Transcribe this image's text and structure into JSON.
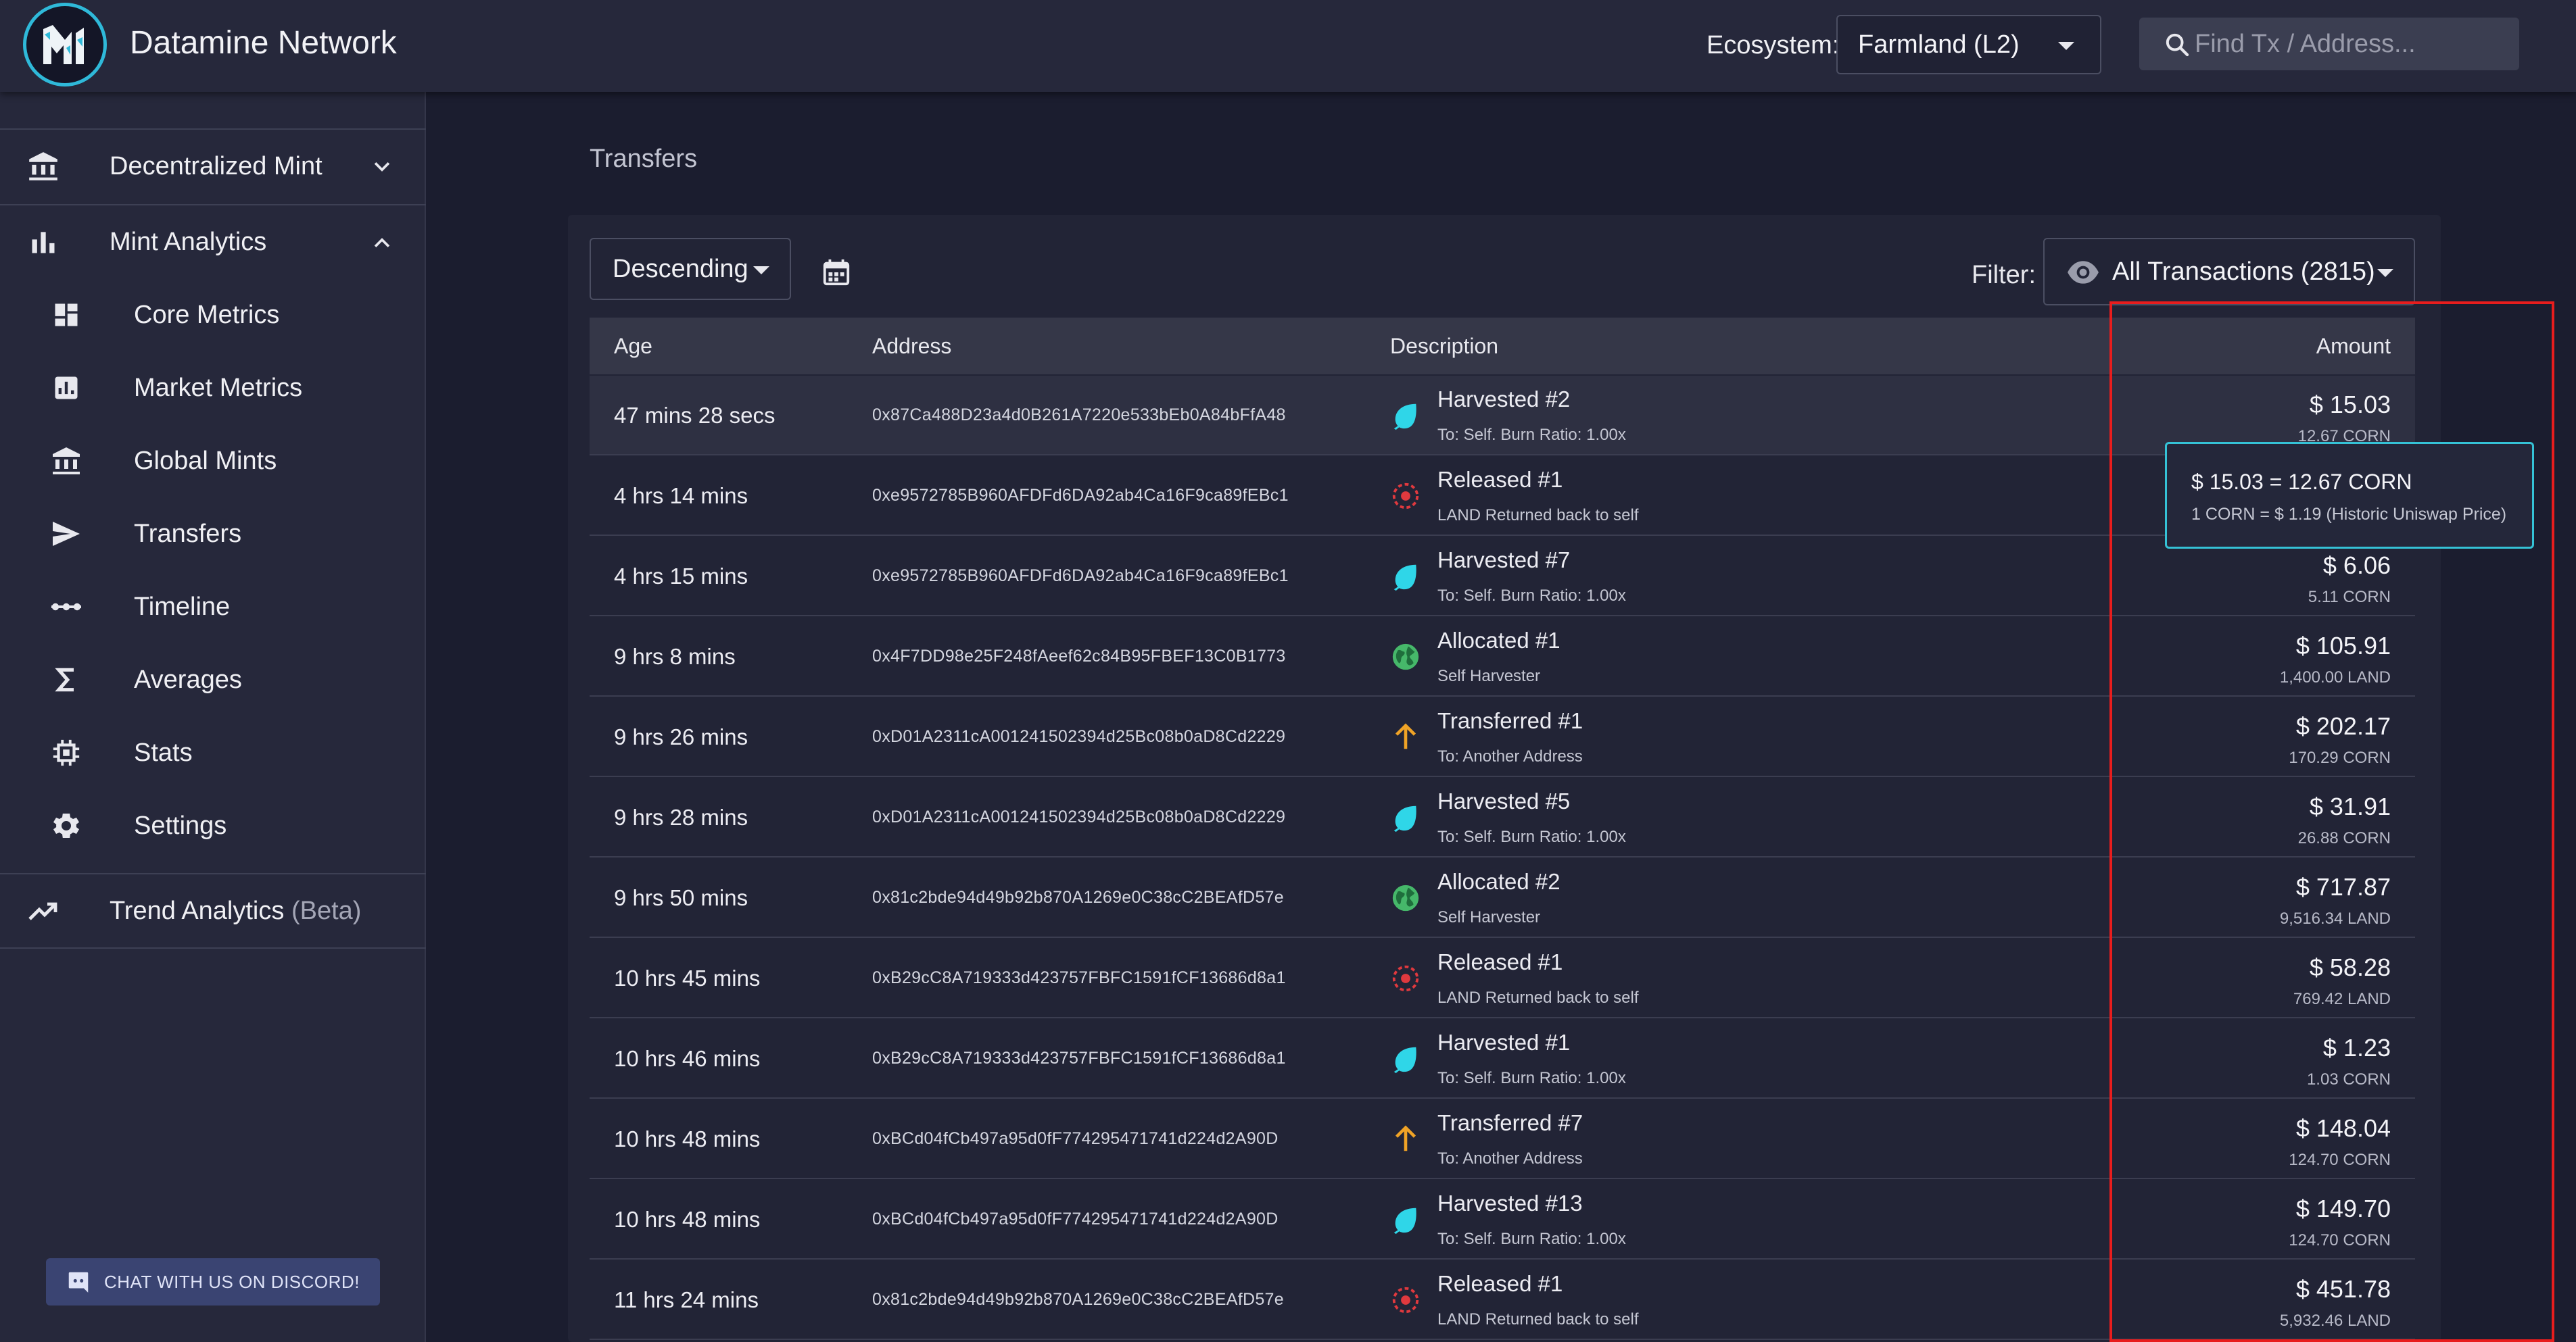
{
  "header": {
    "app_name": "Datamine Network",
    "logo_text": "M1",
    "ecosystem_label": "Ecosystem:",
    "ecosystem_value": "Farmland (L2)",
    "search_placeholder": "Find Tx / Address..."
  },
  "sidebar": {
    "sections": [
      {
        "label": "Decentralized Mint",
        "icon": "bank-icon",
        "chevron": "chevron-down-icon"
      },
      {
        "label": "Mint Analytics",
        "icon": "bar-chart-icon",
        "chevron": "chevron-up-icon"
      }
    ],
    "items": [
      {
        "label": "Core Metrics",
        "icon": "dashboard-icon"
      },
      {
        "label": "Market Metrics",
        "icon": "analytics-icon"
      },
      {
        "label": "Global Mints",
        "icon": "bank-icon"
      },
      {
        "label": "Transfers",
        "icon": "send-icon"
      },
      {
        "label": "Timeline",
        "icon": "timeline-icon"
      },
      {
        "label": "Averages",
        "icon": "sigma-icon"
      },
      {
        "label": "Stats",
        "icon": "chip-icon"
      },
      {
        "label": "Settings",
        "icon": "gear-icon"
      }
    ],
    "trend": {
      "label": "Trend Analytics",
      "beta": "(Beta)",
      "icon": "trending-up-icon"
    },
    "discord_label": "CHAT WITH US ON DISCORD!"
  },
  "main": {
    "title": "Transfers",
    "order_value": "Descending",
    "filter_label": "Filter:",
    "filter_value": "All Transactions (2815)",
    "columns": {
      "age": "Age",
      "address": "Address",
      "description": "Description",
      "amount": "Amount"
    },
    "rows": [
      {
        "age": "47 mins 28 secs",
        "address": "0x87Ca488D23a4d0B261A7220e533bEb0A84bFfA48",
        "icon": "leaf-icon",
        "title": "Harvested #2",
        "sub": "To: Self. Burn Ratio: 1.00x",
        "usd": "$ 15.03",
        "token": "12.67 CORN"
      },
      {
        "age": "4 hrs 14 mins",
        "address": "0xe9572785B960AFDFd6DA92ab4Ca16F9ca89fEBc1",
        "icon": "target-icon",
        "title": "Released #1",
        "sub": "LAND Returned back to self",
        "usd": "",
        "token": ""
      },
      {
        "age": "4 hrs 15 mins",
        "address": "0xe9572785B960AFDFd6DA92ab4Ca16F9ca89fEBc1",
        "icon": "leaf-icon",
        "title": "Harvested #7",
        "sub": "To: Self. Burn Ratio: 1.00x",
        "usd": "$ 6.06",
        "token": "5.11 CORN"
      },
      {
        "age": "9 hrs 8 mins",
        "address": "0x4F7DD98e25F248fAeef62c84B95FBEF13C0B1773",
        "icon": "globe-icon",
        "title": "Allocated #1",
        "sub": "Self Harvester",
        "usd": "$ 105.91",
        "token": "1,400.00 LAND"
      },
      {
        "age": "9 hrs 26 mins",
        "address": "0xD01A2311cA001241502394d25Bc08b0aD8Cd2229",
        "icon": "arrow-up-icon",
        "title": "Transferred #1",
        "sub": "To: Another Address",
        "usd": "$ 202.17",
        "token": "170.29 CORN"
      },
      {
        "age": "9 hrs 28 mins",
        "address": "0xD01A2311cA001241502394d25Bc08b0aD8Cd2229",
        "icon": "leaf-icon",
        "title": "Harvested #5",
        "sub": "To: Self. Burn Ratio: 1.00x",
        "usd": "$ 31.91",
        "token": "26.88 CORN"
      },
      {
        "age": "9 hrs 50 mins",
        "address": "0x81c2bde94d49b92b870A1269e0C38cC2BEAfD57e",
        "icon": "globe-icon",
        "title": "Allocated #2",
        "sub": "Self Harvester",
        "usd": "$ 717.87",
        "token": "9,516.34 LAND"
      },
      {
        "age": "10 hrs 45 mins",
        "address": "0xB29cC8A719333d423757FBFC1591fCF13686d8a1",
        "icon": "target-icon",
        "title": "Released #1",
        "sub": "LAND Returned back to self",
        "usd": "$ 58.28",
        "token": "769.42 LAND"
      },
      {
        "age": "10 hrs 46 mins",
        "address": "0xB29cC8A719333d423757FBFC1591fCF13686d8a1",
        "icon": "leaf-icon",
        "title": "Harvested #1",
        "sub": "To: Self. Burn Ratio: 1.00x",
        "usd": "$ 1.23",
        "token": "1.03 CORN"
      },
      {
        "age": "10 hrs 48 mins",
        "address": "0xBCd04fCb497a95d0fF774295471741d224d2A90D",
        "icon": "arrow-up-icon",
        "title": "Transferred #7",
        "sub": "To: Another Address",
        "usd": "$ 148.04",
        "token": "124.70 CORN"
      },
      {
        "age": "10 hrs 48 mins",
        "address": "0xBCd04fCb497a95d0fF774295471741d224d2A90D",
        "icon": "leaf-icon",
        "title": "Harvested #13",
        "sub": "To: Self. Burn Ratio: 1.00x",
        "usd": "$ 149.70",
        "token": "124.70 CORN"
      },
      {
        "age": "11 hrs 24 mins",
        "address": "0x81c2bde94d49b92b870A1269e0C38cC2BEAfD57e",
        "icon": "target-icon",
        "title": "Released #1",
        "sub": "LAND Returned back to self",
        "usd": "$ 451.78",
        "token": "5,932.46 LAND"
      }
    ],
    "tooltip": {
      "line1": "$ 15.03 = 12.67 CORN",
      "line2": "1 CORN = $ 1.19 (Historic Uniswap Price)"
    }
  },
  "colors": {
    "background": "#1b1d2f",
    "panel": "#26283b",
    "accent": "#35c2d6",
    "leaf": "#2fd6e8",
    "released": "#e0393e",
    "allocated": "#46b86a",
    "transferred": "#f0a326",
    "annotation": "#e81d1d"
  }
}
